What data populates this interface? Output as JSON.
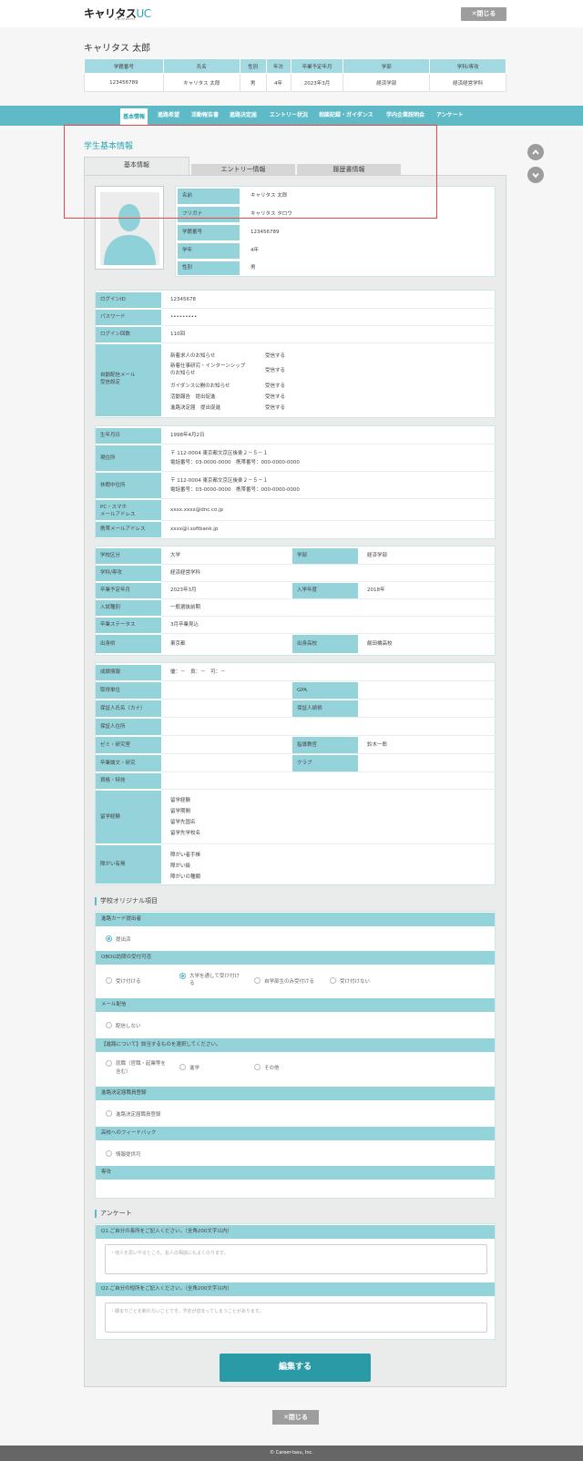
{
  "header": {
    "logo_main": "キャリタス",
    "logo_uc": "UC",
    "logo_sub": "UNIVERSITY",
    "close_label": "✕閉じる"
  },
  "student": {
    "name": "キャリタス 太郎"
  },
  "summary": {
    "headers": [
      "学籍番号",
      "氏名",
      "性別",
      "年次",
      "卒業予定年月",
      "学部",
      "学科/専攻"
    ],
    "values": [
      "123456789",
      "キャリタス 太郎",
      "男",
      "4年",
      "2023年3月",
      "経済学部",
      "経済経営学科"
    ]
  },
  "nav": {
    "items": [
      "基本情報",
      "進路希望",
      "活動報告書",
      "進路決定届",
      "エントリー状況",
      "相談記録・ガイダンス",
      "学内企業説明会",
      "アンケート"
    ]
  },
  "section_title": "学生基本情報",
  "tabs": [
    "基本情報",
    "エントリー情報",
    "履歴書情報"
  ],
  "profile": {
    "labels": [
      "名前",
      "フリガナ",
      "学籍番号",
      "学年",
      "性別"
    ],
    "values": [
      "キャリタス 太郎",
      "キャリタス タロウ",
      "123456789",
      "4年",
      "男"
    ]
  },
  "login": {
    "labels": [
      "ログインID",
      "パスワード",
      "ログイン回数",
      "自動配信メール",
      "受信設定"
    ],
    "values": [
      "12345678",
      "•••••••••",
      "110回"
    ],
    "mail": [
      {
        "name": "新着求人のお知らせ",
        "status": "受信する"
      },
      {
        "name": "新着仕事研究・インターンシップ",
        "name2": "のお知らせ",
        "status": "受信する"
      },
      {
        "name": "ガイダンス公開のお知らせ",
        "status": "受信する"
      },
      {
        "name": "活動報告　提出促進",
        "status": "受信する"
      },
      {
        "name": "進路決定届　提出促進",
        "status": "受信する"
      }
    ]
  },
  "contact": {
    "labels": [
      "生年月日",
      "現住所",
      "休暇中住所",
      "PC・スマホ",
      "メールアドレス",
      "携帯メールアドレス"
    ],
    "birth": "1998年4月2日",
    "addr1": "〒 112-0004  東京都文京区後楽２－５－１",
    "phone1": "電話番号：03-0000-0000　携帯番号：000-0000-0000",
    "addr2": "〒 112-0004  東京都文京区後楽２－５－１",
    "phone2": "電話番号：03-0000-0000　携帯番号：000-0000-0000",
    "pc_mail": "xxxx.xxxx@dnc.co.jp",
    "mobile_mail": "xxxx@i.softbank.jp"
  },
  "school": {
    "labels": [
      "学校区分",
      "学部",
      "学科/専攻",
      "卒業予定年月",
      "入学年度",
      "入試種別",
      "卒業ステータス",
      "出身県",
      "出身高校"
    ],
    "values": [
      "大学",
      "経済学部",
      "経済経営学科",
      "2023年3月",
      "2018年",
      "一般選抜前期",
      "3月卒業見込",
      "東京都",
      "飯田橋高校"
    ]
  },
  "academic": {
    "labels": [
      "成績情報",
      "取得単位",
      "GPA",
      "保証人氏名（カナ）",
      "保証人続柄",
      "保証人住所",
      "ゼミ・研究室",
      "指導教官",
      "卒業論文・研究",
      "クラブ",
      "資格・特技",
      "留学経験",
      "障がい有無"
    ],
    "grades": "優：－　良：－　可：－",
    "advisor": "鈴木一郎",
    "study_abroad": [
      "留学経験",
      "留学期間",
      "留学先国名",
      "留学先学校名"
    ],
    "disability": [
      "障がい者手帳",
      "障がい級",
      "障がいの種類"
    ]
  },
  "original": {
    "title": "学校オリジナル項目",
    "q1": "進路カード提出者",
    "q1_opt": "提出済",
    "q2": "OBOG訪問の受付可否",
    "q2_opts": [
      "受け付ける",
      "大学を通して受け付け",
      "る",
      "自学部生のみ受付ける",
      "受け付けない"
    ],
    "q3": "メール配信",
    "q3_opt": "配信しない",
    "q4": "【進路について】該当するものを選択してください。",
    "q4_opts": [
      "就職（官職・起業等を",
      "含む）",
      "進学",
      "その他"
    ],
    "q5": "進路決定届職員登録",
    "q5_opt": "進路決定届職員登録",
    "q6": "高校へのフィードバック",
    "q6_opt": "情報提供可",
    "q7": "専攻"
  },
  "survey": {
    "title": "アンケート",
    "q1": "Q1.ご自分の長所をご記入ください。（全角200文字以内）",
    "a1": "・他人を思いやるところ。友人の相談にもよくのります。",
    "q2": "Q2.ご自分の短所をご記入ください。（全角200文字以内）",
    "a2": "・細まりごとを断れないことです。予定が詰まってしまうことがあります。"
  },
  "edit_label": "編集する",
  "close_bottom": "✕閉じる",
  "footer": "© Career-tasu, Inc.",
  "colors": {
    "accent": "#2aa7b4",
    "nav": "#5ebac6",
    "label": "#95d3db",
    "edit": "#2a9ba6"
  }
}
